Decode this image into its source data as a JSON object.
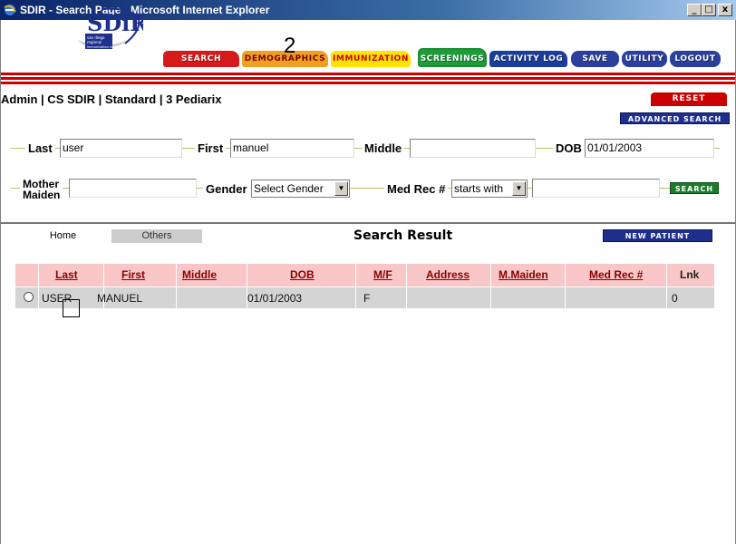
{
  "window": {
    "title": "SDIR - Search Page - Microsoft Internet Explorer",
    "min_glyph": "_",
    "max_glyph": "□",
    "close_glyph": "x"
  },
  "header": {
    "logo_text": "SDiR",
    "logo_subtext": "san diego regional immunization registry",
    "annotation": "2",
    "tabs": {
      "search": "SEARCH",
      "demographics": "DEMOGRAPHICS",
      "immunization": "IMMUNIZATION",
      "screenings": "SCREENINGS",
      "activity_log": "ACTIVITY LOG",
      "save": "SAVE",
      "utility": "UTILITY",
      "logout": "LOGOUT"
    }
  },
  "user_line": "Admin | CS SDIR | Standard | 3 Pediarix",
  "buttons": {
    "reset": "RESET",
    "advanced_search": "ADVANCED SEARCH",
    "search": "SEARCH",
    "new_patient": "NEW PATIENT"
  },
  "form": {
    "last_label": "Last",
    "last_value": "user",
    "first_label": "First",
    "first_value": "manuel",
    "middle_label": "Middle",
    "middle_value": "",
    "dob_label": "DOB",
    "dob_value": "01/01/2003",
    "mother_label_1": "Mother",
    "mother_label_2": "Maiden",
    "mother_value": "",
    "gender_label": "Gender",
    "gender_value": "Select Gender",
    "medrec_label": "Med Rec #",
    "medrec_mode": "starts with",
    "medrec_value": ""
  },
  "results": {
    "tabs": [
      "Home",
      "Others"
    ],
    "title": "Search Result",
    "columns": [
      "Last",
      "First",
      "Middle",
      "DOB",
      "M/F",
      "Address",
      "M.Maiden",
      "Med Rec #",
      "Lnk"
    ],
    "rows": [
      {
        "last": "USER",
        "first": "MANUEL",
        "middle": "",
        "dob": "01/01/2003",
        "mf": "F",
        "address": "",
        "mmaiden": "",
        "medrec": "",
        "lnk": "0"
      }
    ]
  },
  "colors": {
    "search_tab": "#d61a1a",
    "screenings_tab": "#1f9b3a",
    "header_band": "#cc0000",
    "table_header": "#f9c7c7",
    "table_row": "#d4d4d4"
  }
}
